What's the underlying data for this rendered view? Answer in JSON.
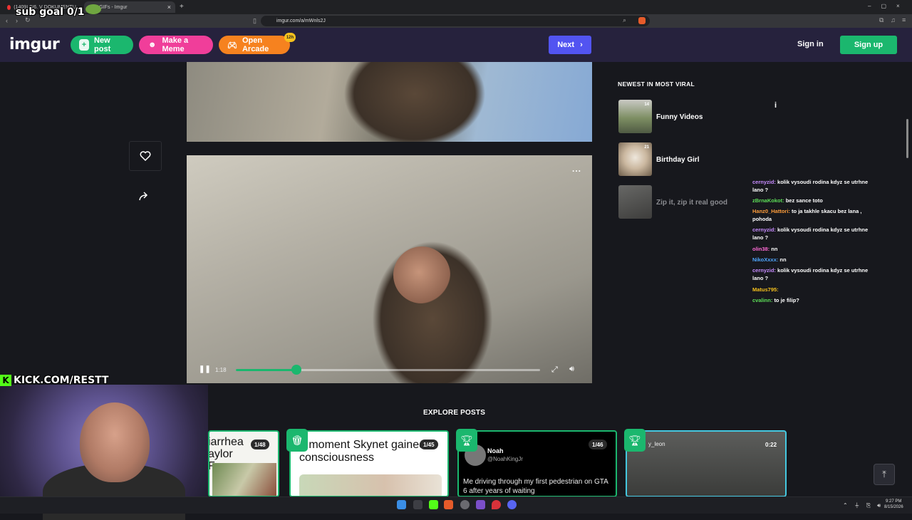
{
  "browser": {
    "tabs": [
      {
        "label": "(1409) 8/6. V DOKUMENTU V ŠTI A...",
        "active": false
      },
      {
        "label": "- GIFs - Imgur",
        "active": true
      }
    ],
    "url": "imgur.com/a/mWnls2J",
    "new_tab": "+"
  },
  "stream_overlay": {
    "sub_goal": "sub goal 0/1",
    "kick_label": "KICK.COM/RESTT",
    "kick_letter": "K"
  },
  "header": {
    "logo": "imgur",
    "new_post": "New post",
    "make_meme": "Make a Meme",
    "open_arcade": "Open Arcade",
    "arcade_badge": "12h",
    "next": "Next",
    "sign_in": "Sign in",
    "sign_up": "Sign up"
  },
  "video": {
    "time": "1:18",
    "progress": 0.2,
    "more": "..."
  },
  "sidebar": {
    "heading": "NEWEST IN MOST VIRAL",
    "items": [
      {
        "title": "Funny Videos",
        "count": "14",
        "dimmed": false
      },
      {
        "title": "Birthday Girl",
        "count": "21",
        "dimmed": false
      },
      {
        "title": "Zip it, zip it real good",
        "count": "",
        "dimmed": true
      }
    ]
  },
  "chat": [
    {
      "user": "cernyzid:",
      "text": "kolik vysoudi rodina kdyz se utrhne lano ?",
      "color": "#c78cff"
    },
    {
      "user": "zBrnaKokot:",
      "text": "bez sance toto",
      "color": "#5ddf58"
    },
    {
      "user": "Hanz0_Hattori:",
      "text": "to ja takhle skacu bez lana , pohoda",
      "color": "#ff9d3b"
    },
    {
      "user": "cernyzid:",
      "text": "kolik vysoudi rodina kdyz se utrhne lano ?",
      "color": "#c78cff"
    },
    {
      "user": "olin38:",
      "text": "nn",
      "color": "#ff6ad5"
    },
    {
      "user": "NikoXxxx:",
      "text": "nn",
      "color": "#4ea6ff"
    },
    {
      "user": "cernyzid:",
      "text": "kolik vysoudi rodina kdyz se utrhne lano ?",
      "color": "#c78cff"
    },
    {
      "user": "Matus795:",
      "text": "",
      "color": "#f7c21d"
    },
    {
      "user": "cvalinn:",
      "text": "to je filip?",
      "color": "#5ddf58"
    }
  ],
  "explore": {
    "heading": "EXPLORE POSTS",
    "cards": [
      {
        "text": "iarrhea aylor Farms",
        "count": "1/48"
      },
      {
        "text": "e moment Skynet gained consciousness",
        "count": "1/45"
      },
      {
        "author": "Noah",
        "handle": "@NoahKingJr",
        "text": "Me driving through my first pedestrian on GTA 6 after years of waiting",
        "count": "1/46"
      },
      {
        "author": "y_leon",
        "count": "0:22"
      }
    ]
  },
  "taskbar": {
    "time": "9:27 PM",
    "date": "8/15/2026"
  },
  "colors": {
    "header_bg": "#26223d",
    "new_post": "#1bb76e",
    "make_meme": "#f03e9a",
    "open_arcade": "#f6821f",
    "next": "#5254f1",
    "sign_up": "#1bb76e",
    "kick_green": "#53fc18"
  }
}
